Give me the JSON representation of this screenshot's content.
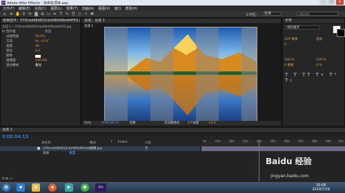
{
  "window": {
    "title": "Adobe After Effects - 未命名项目.aep"
  },
  "menu": [
    "文件(F)",
    "编辑(E)",
    "合成(C)",
    "图层(L)",
    "效果(T)",
    "动画(A)",
    "视图(V)",
    "窗口",
    "帮助(H)"
  ],
  "toolbar": {
    "workspace_label": "工作区：",
    "workspace_value": "标准",
    "search_placeholder": "搜索帮助"
  },
  "effects_panel": {
    "tab": "效果控件：37Dcedd8d922cbd484d9edd4f50.jpg",
    "subtitle": "合成 1 • 37Dcedd8d922cbd484d9edd4f50.jpg",
    "rows": [
      {
        "name": "fx 百叶窗",
        "value": "重置"
      },
      {
        "name": "过渡完成",
        "value": "50.0%"
      },
      {
        "name": "方向",
        "value": "0x +0.0°"
      },
      {
        "name": "宽度",
        "value": "60"
      },
      {
        "name": "羽化",
        "value": "0.0"
      },
      {
        "name": "颜色",
        "value": ""
      },
      {
        "name": "透明度",
        "value": "100.0%"
      },
      {
        "name": "混合模式",
        "value": "叠加"
      }
    ]
  },
  "viewer": {
    "tab": "合成：合成 1",
    "subtab": "合成 1",
    "zoom": "50%",
    "timecode": "0:00:04:13",
    "resolution": "完整",
    "camera": "活动摄像机",
    "views": "1个视图",
    "offset": "+0.0"
  },
  "right_panel": {
    "tab": "字符",
    "font": "微软雅黑",
    "size": "120 像素",
    "leading": "自动",
    "tracking": "0",
    "scale_v": "100 %",
    "scale_h": "100 %",
    "baseline": "0 像素",
    "tsume": "0 %"
  },
  "timeline": {
    "tab": "合成 1",
    "timecode": "0:00:04:13",
    "columns": [
      "源名称",
      "模式",
      "T",
      "TrkMat",
      "父级"
    ],
    "layer_name": "37Dcedd8d922cbd484d9edd4f50.jpg",
    "layer_mode": "正常",
    "layer_parent": "无",
    "sub_row": "效果",
    "sub_value": "重置",
    "ruler": [
      "0s",
      "01s",
      "02s",
      "03s",
      "04s",
      "05s",
      "06s",
      "07s",
      "08s",
      "09s",
      "10s"
    ]
  },
  "taskbar": {
    "time": "20:06",
    "date": "2019/7/19",
    "active_app": "Ae"
  },
  "watermark": {
    "brand": "Baidu 经验",
    "url": "jingyan.baidu.com"
  }
}
